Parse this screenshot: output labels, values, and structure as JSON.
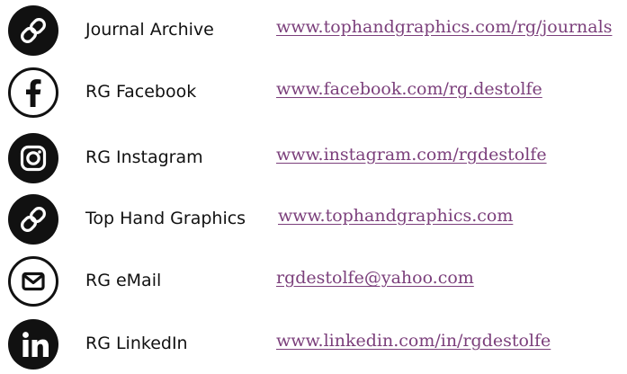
{
  "link_color": "#7b3f7b",
  "links": [
    {
      "icon": "link-icon",
      "label": "Journal Archive",
      "url": "www.tophandgraphics.com/rg/journals"
    },
    {
      "icon": "facebook-icon",
      "label": "RG Facebook",
      "url": "www.facebook.com/rg.destolfe"
    },
    {
      "icon": "instagram-icon",
      "label": "RG Instagram",
      "url": "www.instagram.com/rgdestolfe"
    },
    {
      "icon": "link-icon",
      "label": "Top Hand Graphics",
      "url": "www.tophandgraphics.com"
    },
    {
      "icon": "email-icon",
      "label": "RG eMail",
      "url": "rgdestolfe@yahoo.com"
    },
    {
      "icon": "linkedin-icon",
      "label": "RG LinkedIn",
      "url": "www.linkedin.com/in/rgdestolfe"
    }
  ]
}
